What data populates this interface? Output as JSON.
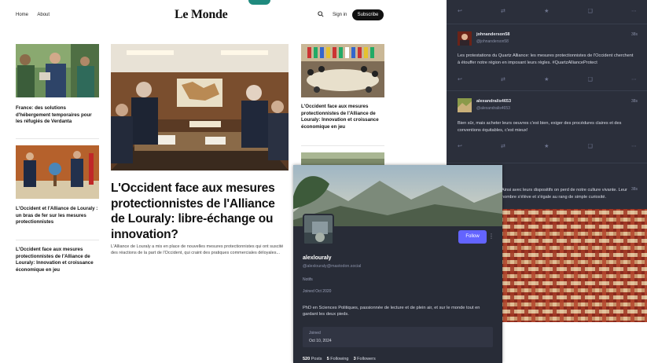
{
  "lemonde": {
    "logo": "Le Monde",
    "nav": [
      "Home",
      "About"
    ],
    "signin": "Sign in",
    "subscribe": "Subscribe",
    "articles": {
      "left1": "France: des solutions d'hébergement temporaires pour les réfugiés de Verdanta",
      "left2": "L'Occident et l'Alliance de Louraly : un bras de fer sur les mesures protectionnistes",
      "left3": "L'Occident face aux mesures protectionnistes de l'Alliance de Louraly: Innovation et croissance économique en jeu",
      "lead_title": "L'Occident face aux mesures protectionnistes de l'Alliance de Louraly: libre-échange ou innovation?",
      "lead_dek": "L'Alliance de Louraly a mis en place de nouvelles mesures protectionnistes qui ont suscité des réactions de la part de l'Occident, qui craint des pratiques commerciales déloyales...",
      "right1": "L'Occident face aux mesures protectionnistes de l'Alliance de Louraly: Innovation et croissance économique en jeu"
    }
  },
  "mastodon": {
    "posts": [
      {
        "name": "johnanderson58",
        "handle": "@johnanderson58",
        "time": "38s",
        "text": "Les protestations du Quartz Alliance: les mesures protectionnistes de l'Occident cherchent à étouffer notre région en imposant leurs règles. #QuartzAllianceProtect"
      },
      {
        "name": "alexandralis4653",
        "handle": "@alexandralis4653",
        "time": "38s",
        "text": "Bien sûr, mais acheter leurs oeuvres c'est bien, exiger des procédures claires et des conventions équitables, c'est mieux!"
      },
      {
        "name": "",
        "handle": "",
        "time": "38s",
        "text": "Ainsi avec leurs dispositifs on perd de notre culture vivante. Leur nombre s'élève et s'égale au rang de simple curiosité."
      }
    ]
  },
  "profile": {
    "follow": "Follow",
    "username": "alexlouraly",
    "handle": "@alexlouraly@mastodon.social",
    "note": "Notifs",
    "joined": "Joined Oct 2020",
    "bio": "PhD en Sciences Politiques, passionnée de lecture et de plein air, et sur le monde tout en gardant les deux pieds.",
    "field_label": "Joined",
    "field_value": "Oct 10, 2024",
    "stats": {
      "posts_count": "520",
      "posts_label": "Posts",
      "following_count": "5",
      "following_label": "Following",
      "followers_count": "3",
      "followers_label": "Followers"
    }
  },
  "colors": {
    "accent_follow": "#6364ff",
    "dark_bg": "#282c37",
    "lm_subscribe": "#111111"
  }
}
